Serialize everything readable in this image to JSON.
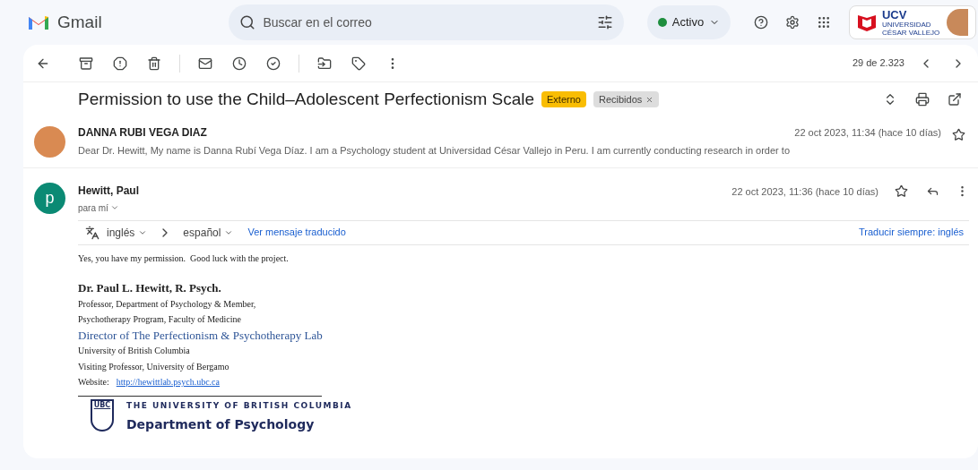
{
  "header": {
    "app_name": "Gmail",
    "search": {
      "placeholder": "Buscar en el correo"
    },
    "status": {
      "label": "Activo",
      "on": true
    },
    "account_logo": {
      "name": "UCV",
      "subtitle": "UNIVERSIDAD CÉSAR VALLEJO"
    }
  },
  "toolbar": {
    "counter": "29 de 2.323"
  },
  "thread": {
    "subject": "Permission to use the Child–Adolescent Perfectionism Scale",
    "labels": [
      {
        "text": "Externo",
        "kind": "external",
        "removable": false
      },
      {
        "text": "Recibidos",
        "kind": "folder",
        "removable": true
      }
    ],
    "messages": [
      {
        "kind": "collapsed",
        "sender": "DANNA RUBI VEGA DIAZ",
        "date": "22 oct 2023, 11:34 (hace 10 días)",
        "snippet": "Dear Dr. Hewitt, My name is Danna Rubí Vega Díaz. I am a Psychology student at Universidad César Vallejo in Peru. I am currently conducting research in order to",
        "starred": false
      },
      {
        "kind": "expanded",
        "sender": "Hewitt, Paul",
        "avatar_letter": "p",
        "recipient": "para mí",
        "date": "22 oct 2023, 11:36 (hace 10 días)",
        "starred": false,
        "translate": {
          "from": "inglés",
          "to": "español",
          "link": "Ver mensaje traducido",
          "always": "Traducir siempre: inglés"
        },
        "body": "Yes, you have my permission.  Good luck with the project.",
        "signature": {
          "name": "Dr. Paul L. Hewitt, R. Psych.",
          "lines": [
            "Professor, Department of Psychology & Member,",
            "Psychotherapy Program, Faculty of Medicine"
          ],
          "highlight": "Director of The Perfectionism & Psychotherapy Lab",
          "lines_after": [
            "University of British Columbia",
            "Visiting Professor, University of Bergamo"
          ],
          "website_label": "Website:",
          "website": "http://hewittlab.psych.ubc.ca",
          "logo": {
            "shield": "UBC",
            "university": "THE UNIVERSITY OF BRITISH COLUMBIA",
            "department": "Department of Psychology"
          }
        }
      }
    ]
  }
}
